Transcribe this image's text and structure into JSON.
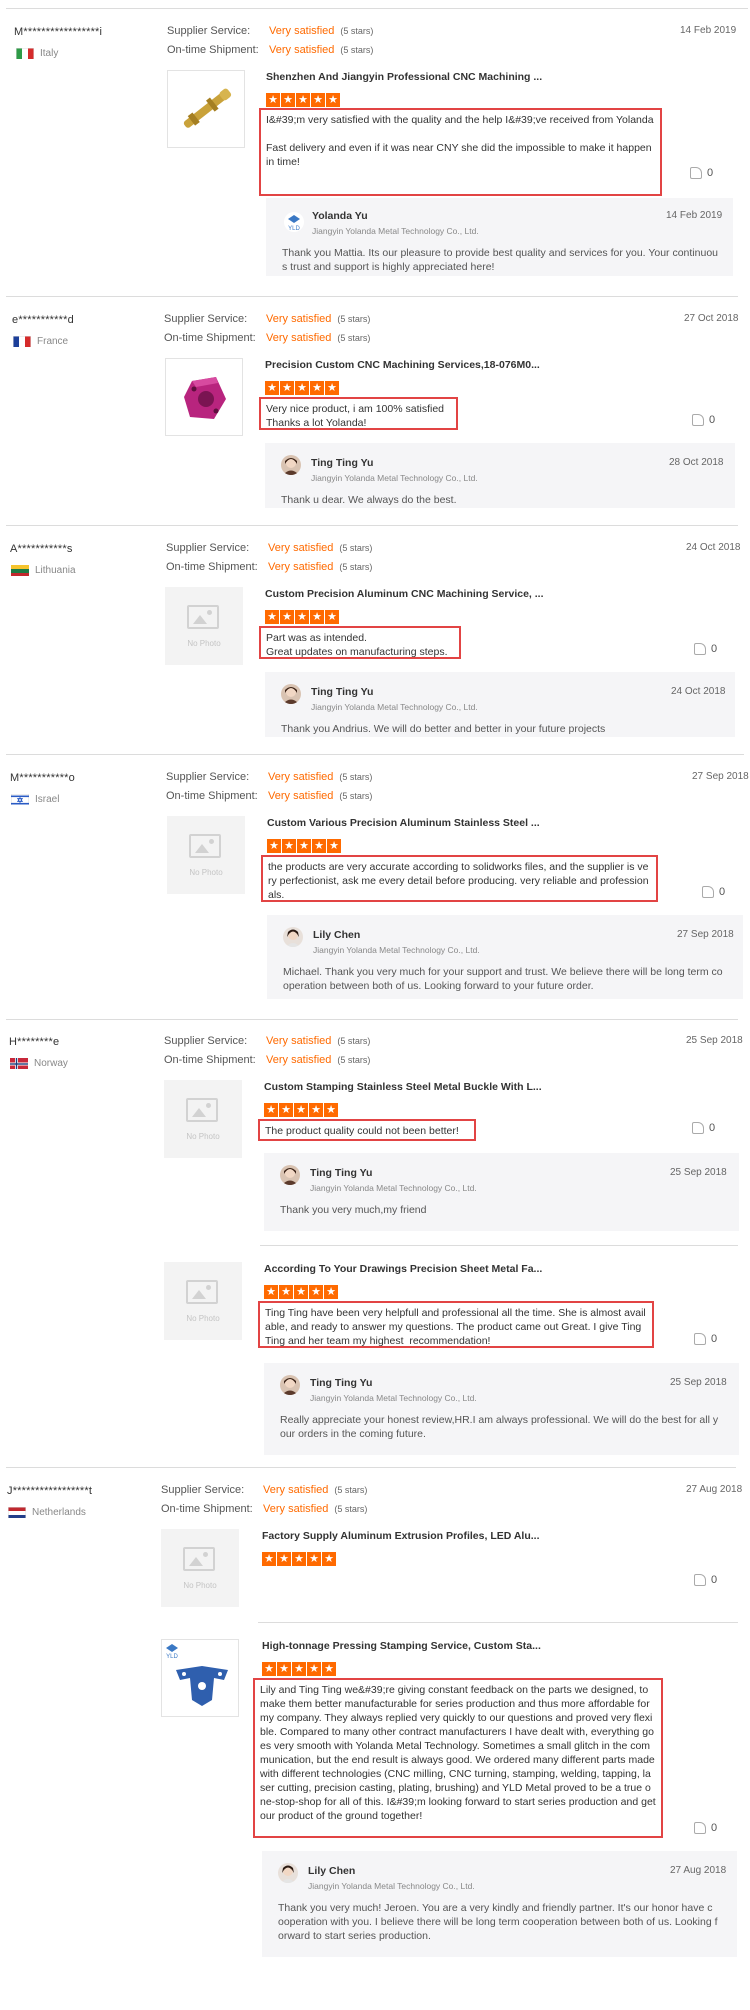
{
  "labels": {
    "supplier_service": "Supplier Service:",
    "ontime_shipment": "On-time Shipment:",
    "rating_value": "Very satisfied",
    "rating_stars": "(5 stars)",
    "no_photo": "No Photo"
  },
  "colors": {
    "accent": "#ff6a00",
    "highlight_border": "#e24444",
    "reply_bg": "#f5f5f7"
  },
  "reviews": [
    {
      "buyer": "M*****************i",
      "country": "Italy",
      "flag": "italy-flag",
      "date": "14 Feb 2019",
      "items": [
        {
          "product": "Shenzhen And Jiangyin Professional CNC Machining ...",
          "rating": 5,
          "comment": "I&#39;m very satisfied with the quality and the help I&#39;ve received from Yolanda\n\nFast delivery and even if it was near CNY she did the impossible to make it happen in time!",
          "likes": "0",
          "reply": {
            "name": "Yolanda Yu",
            "company": "Jiangyin Yolanda Metal Technology Co., Ltd.",
            "date": "14 Feb 2019",
            "text": "Thank you Mattia. Its our pleasure to provide best quality and services for you. Your continuous trust and support is highly appreciated here!"
          }
        }
      ]
    },
    {
      "buyer": "e***********d",
      "country": "France",
      "flag": "france-flag",
      "date": "27 Oct 2018",
      "items": [
        {
          "product": "Precision Custom CNC Machining Services,18-076M0...",
          "rating": 5,
          "comment": "Very nice product, i am 100% satisfied\nThanks a lot Yolanda!",
          "likes": "0",
          "reply": {
            "name": "Ting Ting Yu",
            "company": "Jiangyin Yolanda Metal Technology Co., Ltd.",
            "date": "28 Oct 2018",
            "text": "Thank u dear. We always do the best."
          }
        }
      ]
    },
    {
      "buyer": "A***********s",
      "country": "Lithuania",
      "flag": "lithuania-flag",
      "date": "24 Oct 2018",
      "items": [
        {
          "product": "Custom Precision Aluminum CNC Machining Service, ...",
          "rating": 5,
          "comment": "Part was as intended.\nGreat updates on manufacturing steps.",
          "likes": "0",
          "reply": {
            "name": "Ting Ting Yu",
            "company": "Jiangyin Yolanda Metal Technology Co., Ltd.",
            "date": "24 Oct 2018",
            "text": "Thank you Andrius. We will do better and better in your future projects"
          }
        }
      ]
    },
    {
      "buyer": "M***********o",
      "country": "Israel",
      "flag": "israel-flag",
      "date": "27 Sep 2018",
      "items": [
        {
          "product": "Custom Various Precision Aluminum Stainless Steel ...",
          "rating": 5,
          "comment": "the products are very accurate according to solidworks files, and the supplier is very perfectionist, ask me every detail before producing. very reliable and professionals.",
          "likes": "0",
          "reply": {
            "name": "Lily Chen",
            "company": "Jiangyin Yolanda Metal Technology Co., Ltd.",
            "date": "27 Sep 2018",
            "text": "Michael. Thank you very much for your support and trust. We believe there will be long term cooperation between both of us. Looking forward to your future order."
          }
        }
      ]
    },
    {
      "buyer": "H********e",
      "country": "Norway",
      "flag": "norway-flag",
      "date": "25 Sep 2018",
      "items": [
        {
          "product": "Custom Stamping Stainless Steel Metal Buckle With L...",
          "rating": 5,
          "comment": "The product quality could not been better!",
          "likes": "0",
          "reply": {
            "name": "Ting Ting Yu",
            "company": "Jiangyin Yolanda Metal Technology Co., Ltd.",
            "date": "25 Sep 2018",
            "text": "Thank you very much,my friend"
          }
        },
        {
          "product": "According To Your Drawings Precision Sheet Metal Fa...",
          "rating": 5,
          "comment": "Ting Ting have been very helpfull and professional all the time. She is almost available, and ready to answer my questions. The product came out Great. I give Ting Ting and her team my highest  recommendation!",
          "likes": "0",
          "reply": {
            "name": "Ting Ting Yu",
            "company": "Jiangyin Yolanda Metal Technology Co., Ltd.",
            "date": "25 Sep 2018",
            "text": "Really appreciate your honest review,HR.I am always professional. We will do the best for all your orders in the coming future."
          }
        }
      ]
    },
    {
      "buyer": "J*****************t",
      "country": "Netherlands",
      "flag": "netherlands-flag",
      "date": "27 Aug 2018",
      "items": [
        {
          "product": "Factory Supply Aluminum Extrusion Profiles, LED Alu...",
          "rating": 5,
          "comment": "",
          "likes": "0"
        },
        {
          "product": "High-tonnage Pressing Stamping Service, Custom Sta...",
          "rating": 5,
          "comment": "Lily and Ting Ting we&#39;re giving constant feedback on the parts we designed, to make them better manufacturable for series production and thus more affordable for my company. They always replied very quickly to our questions and proved very flexible. Compared to many other contract manufacturers I have dealt with, everything goes very smooth with Yolanda Metal Technology. Sometimes a small glitch in the communication, but the end result is always good. We ordered many different parts made with different technologies (CNC milling, CNC turning, stamping, welding, tapping, laser cutting, precision casting, plating, brushing) and YLD Metal proved to be a true one-stop-shop for all of this. I&#39;m looking forward to start series production and get our product of the ground together!",
          "likes": "0",
          "reply": {
            "name": "Lily Chen",
            "company": "Jiangyin Yolanda Metal Technology Co., Ltd.",
            "date": "27 Aug 2018",
            "text": "Thank you very much! Jeroen.  You are a very kindly and friendly partner. It's our honor have cooperation with you. I believe there will be long term cooperation between both of us. Looking forward to start series production."
          }
        }
      ]
    }
  ]
}
